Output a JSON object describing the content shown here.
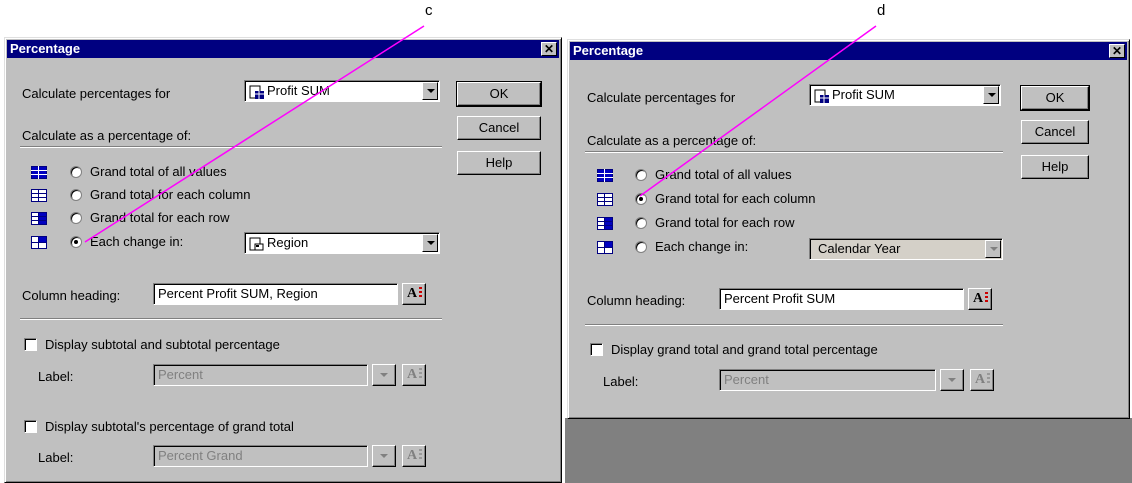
{
  "callouts": {
    "c": "c",
    "d": "d"
  },
  "colors": {
    "title_bar": "#000080",
    "dialog_bg": "#c0c0c0",
    "callout_line": "#ff00ff"
  },
  "left": {
    "title": "Percentage",
    "calc_for_label": "Calculate percentages for",
    "calc_for_value": "Profit SUM",
    "ok": "OK",
    "cancel": "Cancel",
    "help": "Help",
    "calc_as_label": "Calculate as a percentage of:",
    "options": [
      {
        "label": "Grand total of all values",
        "selected": false
      },
      {
        "label": "Grand total for each column",
        "selected": false
      },
      {
        "label": "Grand total for each row",
        "selected": false
      },
      {
        "label": "Each change in:",
        "selected": true
      }
    ],
    "change_in_value": "Region",
    "column_heading_label": "Column heading:",
    "column_heading_value": "Percent Profit SUM, Region",
    "subtotal_check_label": "Display subtotal and subtotal percentage",
    "label1": "Label:",
    "label1_value": "Percent",
    "grand_check_label": "Display subtotal's percentage of grand total",
    "label2": "Label:",
    "label2_value": "Percent Grand"
  },
  "right": {
    "title": "Percentage",
    "calc_for_label": "Calculate percentages for",
    "calc_for_value": "Profit SUM",
    "ok": "OK",
    "cancel": "Cancel",
    "help": "Help",
    "calc_as_label": "Calculate as a percentage of:",
    "options": [
      {
        "label": "Grand total of all values",
        "selected": false
      },
      {
        "label": "Grand total for each column",
        "selected": true
      },
      {
        "label": "Grand total for each row",
        "selected": false
      },
      {
        "label": "Each change in:",
        "selected": false
      }
    ],
    "change_in_value": "Calendar Year",
    "column_heading_label": "Column heading:",
    "column_heading_value": "Percent Profit SUM",
    "grand_check_label": "Display grand total and grand total percentage",
    "label1": "Label:",
    "label1_value": "Percent"
  }
}
